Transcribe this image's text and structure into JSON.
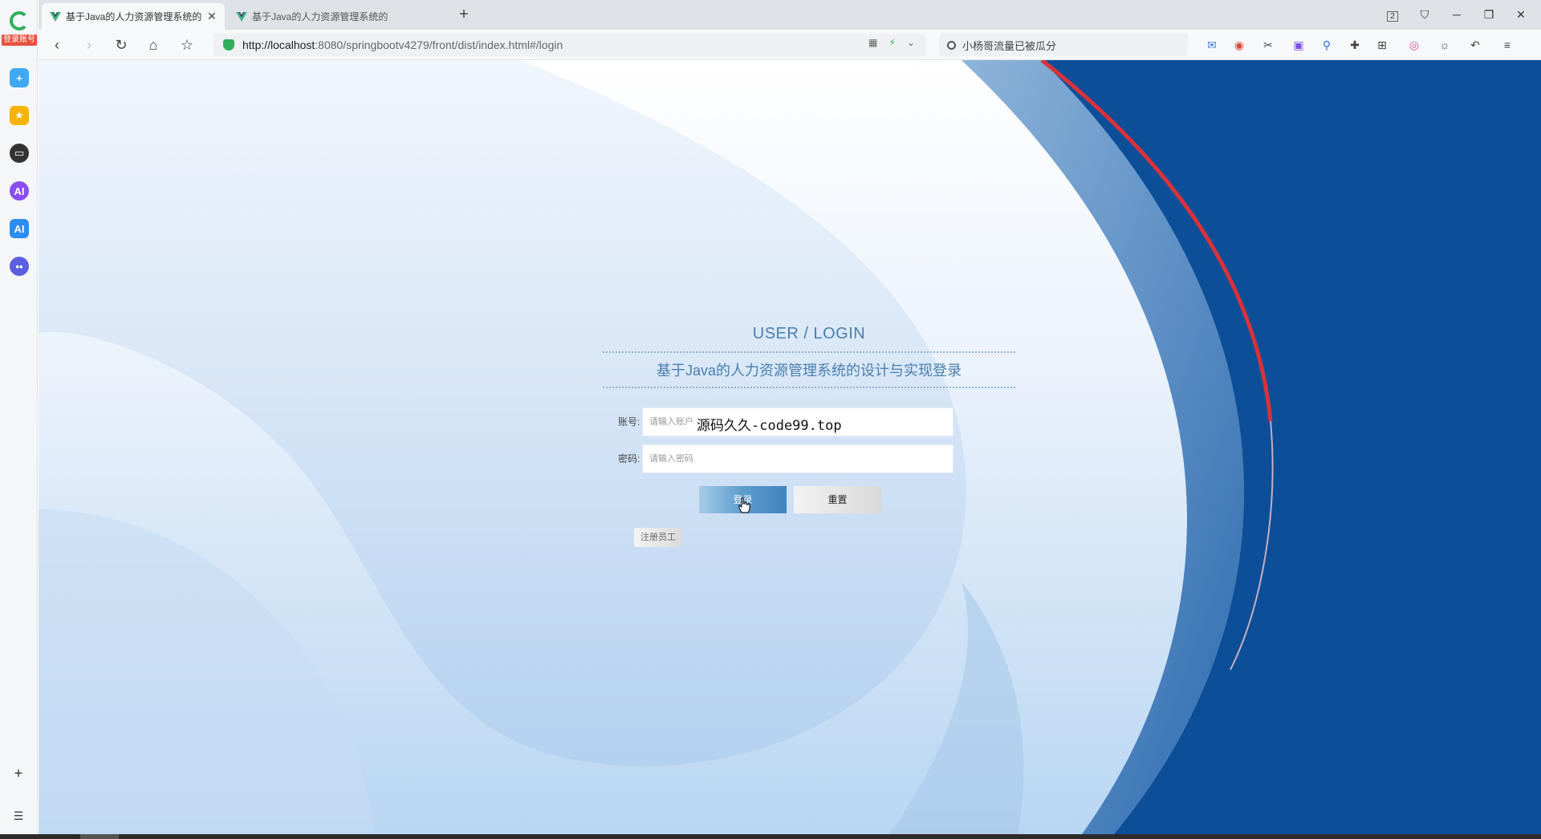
{
  "sidebar": {
    "badge": "登录账号",
    "items": [
      {
        "icon": "plus-square-icon",
        "color": "#3fa9f5"
      },
      {
        "icon": "star-icon",
        "color": "#f5b400"
      },
      {
        "icon": "robot-icon",
        "color": "#333333"
      },
      {
        "icon": "ai-assistant-icon",
        "color": "#8a4ef0",
        "text": "AI"
      },
      {
        "icon": "ai-chat-icon",
        "color": "#2d8cf0",
        "text": "AI"
      },
      {
        "icon": "bot-face-icon",
        "color": "#5b5fe0"
      }
    ]
  },
  "tabs": [
    {
      "label": "基于Java的人力资源管理系统的",
      "active": true
    },
    {
      "label": "基于Java的人力资源管理系统的",
      "active": false
    }
  ],
  "window": {
    "tab_count": "2"
  },
  "address": {
    "url_host": "http://localhost",
    "url_rest": ":8080/springbootv4279/front/dist/index.html#/login"
  },
  "search": {
    "placeholder": "小杨哥流量已被瓜分"
  },
  "login": {
    "title": "USER / LOGIN",
    "subtitle": "基于Java的人力资源管理系统的设计与实现登录",
    "account_label": "账号:",
    "account_placeholder": "请输入账户",
    "password_label": "密码:",
    "password_placeholder": "请输入密码",
    "login_button": "登录",
    "reset_button": "重置",
    "register_button": "注册员工",
    "watermark": "源码久久-code99.top"
  },
  "colors": {
    "accent": "#4a7fae",
    "right_panel": "#0d4e98",
    "red_stripe": "#d8323a"
  }
}
